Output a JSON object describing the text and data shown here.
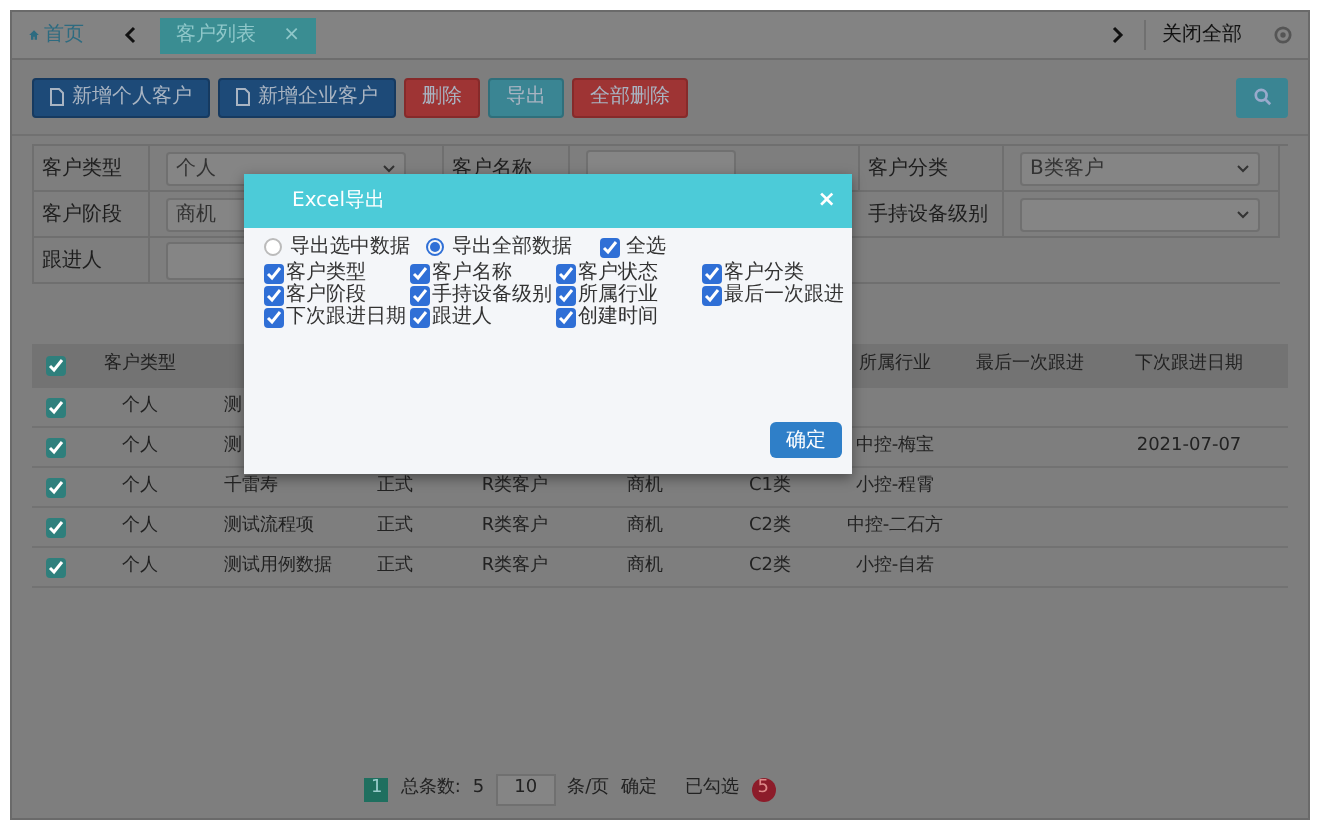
{
  "tab_bar": {
    "home": "首页",
    "tabs": [
      {
        "label": "客户列表",
        "selected": true,
        "close": "×"
      }
    ],
    "close_all": "关闭全部"
  },
  "toolbar": [
    {
      "label": "新增个人客户",
      "kind": "primary"
    },
    {
      "label": "新增企业客户",
      "kind": "primary"
    },
    {
      "label": "删除",
      "kind": "danger"
    },
    {
      "label": "导出",
      "kind": "info"
    },
    {
      "label": "全部删除",
      "kind": "danger"
    }
  ],
  "filters": [
    {
      "left": {
        "label": "客户类型",
        "kind": "select",
        "value": "个人"
      },
      "middle": {
        "label": "客户名称",
        "kind": "input"
      },
      "right": {
        "label": "客户分类",
        "kind": "select",
        "value": "B类客户"
      }
    },
    {
      "left": {
        "label": "客户阶段",
        "kind": "select",
        "value": "商机"
      },
      "right": {
        "label": "手持设备级别",
        "kind": "select"
      }
    },
    {
      "left": {
        "label": "跟进人",
        "kind": "input"
      }
    }
  ],
  "table": {
    "all_checked": true,
    "columns": [
      "客户类型",
      null,
      null,
      null,
      null,
      null,
      "所属行业",
      "最后一次跟进",
      "下次跟进日期"
    ],
    "rows": [
      {
        "checked": true,
        "cells": [
          "个人",
          "测"
        ]
      },
      {
        "checked": true,
        "cells": [
          "个人",
          "测",
          null,
          null,
          null,
          null,
          "中控-梅宝",
          null,
          "2021-07-07"
        ]
      },
      {
        "checked": true,
        "cells": [
          "个人",
          "千雷寿",
          "正式",
          "R类客户",
          "商机",
          "C1类",
          "小控-程霄"
        ]
      },
      {
        "checked": true,
        "cells": [
          "个人",
          "测试流程项",
          "正式",
          "R类客户",
          "商机",
          "C2类",
          "中控-二石方"
        ]
      },
      {
        "checked": true,
        "cells": [
          "个人",
          "测试用例数据",
          "正式",
          "R类客户",
          "商机",
          "C2类",
          "小控-自若"
        ]
      }
    ]
  },
  "pagination": {
    "page": "1",
    "total_label": "总条数:",
    "total": "5",
    "page_size": "10",
    "per_page": "条/页",
    "go": "确定",
    "checked_label": "已勾选",
    "checked_count": "5"
  },
  "dialog": {
    "title": "Excel导出",
    "close": "×",
    "options": [
      {
        "label": "导出选中数据",
        "selected": false
      },
      {
        "label": "导出全部数据",
        "selected": true
      }
    ],
    "select_all": {
      "label": "全选",
      "checked": true
    },
    "fields": [
      {
        "label": "客户类型",
        "checked": true
      },
      {
        "label": "客户名称",
        "checked": true
      },
      {
        "label": "客户状态",
        "checked": true
      },
      {
        "label": "客户分类",
        "checked": true
      },
      {
        "label": "客户阶段",
        "checked": true
      },
      {
        "label": "手持设备级别",
        "checked": true
      },
      {
        "label": "所属行业",
        "checked": true
      },
      {
        "label": "最后一次跟进",
        "checked": true
      },
      {
        "label": "下次跟进日期",
        "checked": true
      },
      {
        "label": "跟进人",
        "checked": true
      },
      {
        "label": "创建时间",
        "checked": true
      }
    ],
    "confirm": "确定"
  }
}
